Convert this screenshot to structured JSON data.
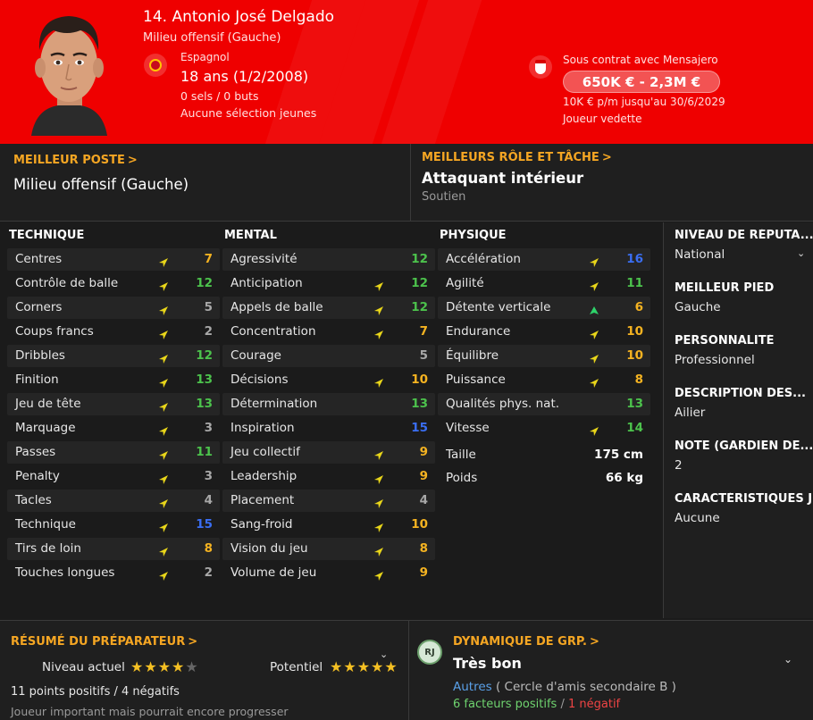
{
  "header": {
    "name": "14. Antonio José Delgado",
    "position": "Milieu offensif (Gauche)",
    "nationality": "Espagnol",
    "age": "18 ans (1/2/2008)",
    "caps": "0 sels / 0 buts",
    "youth_caps": "Aucune sélection jeunes",
    "contract": "Sous contrat avec Mensajero",
    "value": "650K € - 2,3M €",
    "wage": "10K € p/m jusqu'au 30/6/2029",
    "status": "Joueur vedette",
    "icons": {
      "portrait": "player-portrait",
      "flag": "spain-flag-icon",
      "club": "club-badge-icon"
    },
    "colors": {
      "background": "#ef0000"
    }
  },
  "best_position": {
    "title": "MEILLEUR POSTE",
    "chevron": ">",
    "value": "Milieu offensif (Gauche)"
  },
  "best_role": {
    "title": "MEILLEURS RÔLE ET TÂCHE",
    "chevron": ">",
    "value": "Attaquant intérieur",
    "duty": "Soutien"
  },
  "columns": [
    {
      "title": "TECHNIQUE",
      "rows": [
        {
          "label": "Centres",
          "value": "7",
          "trend": "up-yellow"
        },
        {
          "label": "Contrôle de balle",
          "value": "12",
          "trend": "up-yellow"
        },
        {
          "label": "Corners",
          "value": "5",
          "trend": "up-yellow"
        },
        {
          "label": "Coups francs",
          "value": "2",
          "trend": "up-yellow"
        },
        {
          "label": "Dribbles",
          "value": "12",
          "trend": "up-yellow"
        },
        {
          "label": "Finition",
          "value": "13",
          "trend": "up-yellow"
        },
        {
          "label": "Jeu de tête",
          "value": "13",
          "trend": "up-yellow"
        },
        {
          "label": "Marquage",
          "value": "3",
          "trend": "up-yellow"
        },
        {
          "label": "Passes",
          "value": "11",
          "trend": "up-yellow"
        },
        {
          "label": "Penalty",
          "value": "3",
          "trend": "up-yellow"
        },
        {
          "label": "Tacles",
          "value": "4",
          "trend": "up-yellow"
        },
        {
          "label": "Technique",
          "value": "15",
          "trend": "up-yellow"
        },
        {
          "label": "Tirs de loin",
          "value": "8",
          "trend": "up-yellow"
        },
        {
          "label": "Touches longues",
          "value": "2",
          "trend": "up-yellow"
        }
      ]
    },
    {
      "title": "MENTAL",
      "rows": [
        {
          "label": "Agressivité",
          "value": "12",
          "trend": "none"
        },
        {
          "label": "Anticipation",
          "value": "12",
          "trend": "up-yellow"
        },
        {
          "label": "Appels de balle",
          "value": "12",
          "trend": "up-yellow"
        },
        {
          "label": "Concentration",
          "value": "7",
          "trend": "up-yellow"
        },
        {
          "label": "Courage",
          "value": "5",
          "trend": "none"
        },
        {
          "label": "Décisions",
          "value": "10",
          "trend": "up-yellow"
        },
        {
          "label": "Détermination",
          "value": "13",
          "trend": "none"
        },
        {
          "label": "Inspiration",
          "value": "15",
          "trend": "none"
        },
        {
          "label": "Jeu collectif",
          "value": "9",
          "trend": "up-yellow"
        },
        {
          "label": "Leadership",
          "value": "9",
          "trend": "up-yellow"
        },
        {
          "label": "Placement",
          "value": "4",
          "trend": "up-yellow"
        },
        {
          "label": "Sang-froid",
          "value": "10",
          "trend": "up-yellow"
        },
        {
          "label": "Vision du jeu",
          "value": "8",
          "trend": "up-yellow"
        },
        {
          "label": "Volume de jeu",
          "value": "9",
          "trend": "up-yellow"
        }
      ]
    },
    {
      "title": "PHYSIQUE",
      "rows": [
        {
          "label": "Accélération",
          "value": "16",
          "trend": "up-yellow"
        },
        {
          "label": "Agilité",
          "value": "11",
          "trend": "up-yellow"
        },
        {
          "label": "Détente verticale",
          "value": "6",
          "trend": "up-green"
        },
        {
          "label": "Endurance",
          "value": "10",
          "trend": "up-yellow"
        },
        {
          "label": "Équilibre",
          "value": "10",
          "trend": "up-yellow"
        },
        {
          "label": "Puissance",
          "value": "8",
          "trend": "up-yellow"
        },
        {
          "label": "Qualités phys. nat.",
          "value": "13",
          "trend": "none"
        },
        {
          "label": "Vitesse",
          "value": "14",
          "trend": "up-yellow"
        }
      ],
      "extras": [
        {
          "label": "Taille",
          "value": "175 cm"
        },
        {
          "label": "Poids",
          "value": "66 kg"
        }
      ]
    }
  ],
  "info_panel": [
    {
      "title": "NIVEAU DE RÉPUTA...",
      "value": "National",
      "chevron": true
    },
    {
      "title": "MEILLEUR PIED",
      "value": "Gauche"
    },
    {
      "title": "PERSONNALITÉ",
      "value": "Professionnel"
    },
    {
      "title": "DESCRIPTION DES...",
      "value": "Ailier"
    },
    {
      "title": "NOTE (GARDIEN DE...",
      "value": "2"
    },
    {
      "title": "CARACTÉRISTIQUES J",
      "value": "Aucune"
    }
  ],
  "coach": {
    "title": "RÉSUMÉ DU PRÉPARATEUR",
    "chevron": ">",
    "current_label": "Niveau actuel",
    "current_stars": 4,
    "potential_label": "Potentiel",
    "potential_stars": 4.5,
    "points": "11 points positifs / 4 négatifs",
    "note": "Joueur important mais pourrait encore progresser"
  },
  "dynamics": {
    "avatar_initials": "RJ",
    "title": "DYNAMIQUE DE GRP.",
    "chevron": ">",
    "value": "Très bon",
    "group_link": "Autres",
    "group_detail": "( Cercle d'amis secondaire B )",
    "positive": "6 facteurs positifs",
    "separator": " / ",
    "negative": "1 négatif"
  },
  "colors": {
    "accent_orange": "#f5a623",
    "attr_high_blue": "#3a6ef2",
    "attr_good_green": "#4cc24c",
    "attr_mid_orange": "#f5b321",
    "attr_low_grey": "#a8a8a8",
    "trend_yellow": "#e9d61a",
    "trend_green": "#2ed36a"
  }
}
